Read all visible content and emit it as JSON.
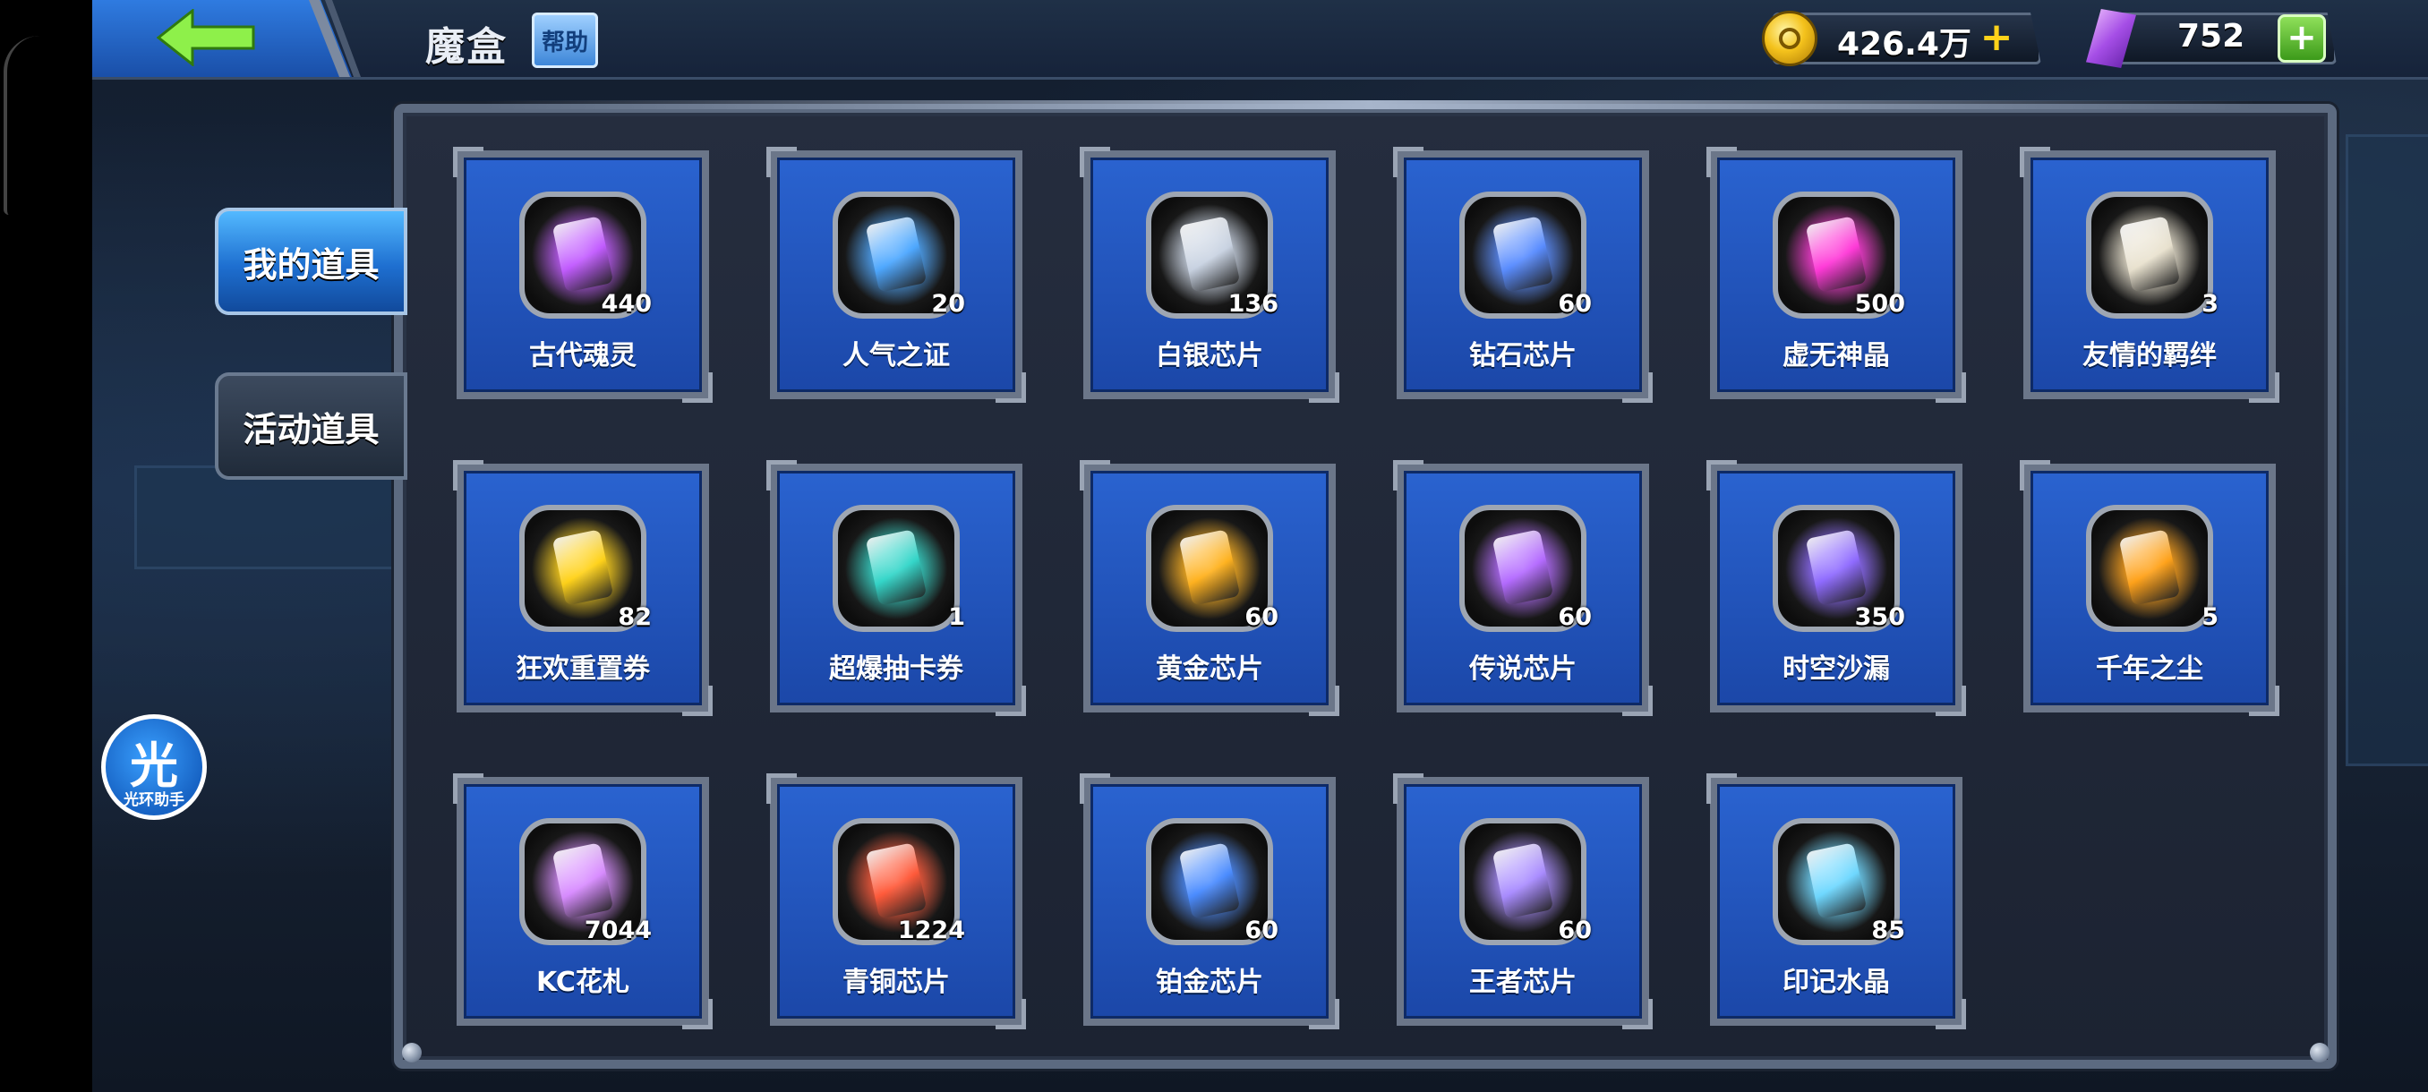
{
  "header": {
    "title": "魔盒",
    "help_label": "帮助",
    "gold_value": "426.4万",
    "gold_plus": "+",
    "gem_value": "752",
    "gem_plus": "+"
  },
  "tabs": [
    {
      "label": "我的道具",
      "active": true
    },
    {
      "label": "活动道具",
      "active": false
    }
  ],
  "assistant": {
    "glyph": "光",
    "label": "光环助手"
  },
  "items": [
    {
      "name": "古代魂灵",
      "count": "440",
      "icon": "ancient-soul-icon",
      "color": "#c25cff"
    },
    {
      "name": "人气之证",
      "count": "20",
      "icon": "popularity-card-icon",
      "color": "#4ea8ff"
    },
    {
      "name": "白银芯片",
      "count": "136",
      "icon": "silver-chip-icon",
      "color": "#c9d3e2"
    },
    {
      "name": "钻石芯片",
      "count": "60",
      "icon": "diamond-chip-icon",
      "color": "#5a8dff"
    },
    {
      "name": "虚无神晶",
      "count": "500",
      "icon": "void-crystal-icon",
      "color": "#ff3ad8"
    },
    {
      "name": "友情的羁绊",
      "count": "3",
      "icon": "friendship-bond-icon",
      "color": "#e9e2cf"
    },
    {
      "name": "狂欢重置券",
      "count": "82",
      "icon": "carnival-reset-ticket-icon",
      "color": "#ffd21a"
    },
    {
      "name": "超爆抽卡券",
      "count": "1",
      "icon": "super-draw-ticket-icon",
      "color": "#34d6c9"
    },
    {
      "name": "黄金芯片",
      "count": "60",
      "icon": "gold-chip-icon",
      "color": "#ffb21f"
    },
    {
      "name": "传说芯片",
      "count": "60",
      "icon": "legend-chip-icon",
      "color": "#b46bff"
    },
    {
      "name": "时空沙漏",
      "count": "350",
      "icon": "hourglass-icon",
      "color": "#8f6bff"
    },
    {
      "name": "千年之尘",
      "count": "5",
      "icon": "millennium-dust-icon",
      "color": "#ffa21a"
    },
    {
      "name": "KC花札",
      "count": "7044",
      "icon": "kc-card-icon",
      "color": "#d88cff"
    },
    {
      "name": "青铜芯片",
      "count": "1224",
      "icon": "bronze-chip-icon",
      "color": "#ff5a3a"
    },
    {
      "name": "铂金芯片",
      "count": "60",
      "icon": "platinum-chip-icon",
      "color": "#4b8cff"
    },
    {
      "name": "王者芯片",
      "count": "60",
      "icon": "king-chip-icon",
      "color": "#a98cff"
    },
    {
      "name": "印记水晶",
      "count": "85",
      "icon": "mark-crystal-icon",
      "color": "#6fd8ff"
    }
  ]
}
